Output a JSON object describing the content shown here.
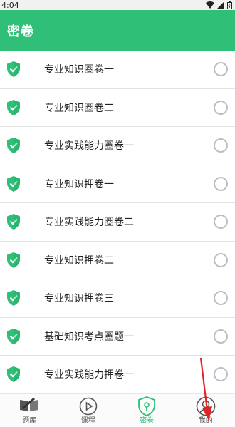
{
  "status_bar": {
    "time": "4:04"
  },
  "app_bar": {
    "title": "密卷"
  },
  "papers": [
    {
      "title": "专业知识圈卷一"
    },
    {
      "title": "专业知识圈卷二"
    },
    {
      "title": "专业实践能力圈卷一"
    },
    {
      "title": "专业知识押卷一"
    },
    {
      "title": "专业实践能力圈卷二"
    },
    {
      "title": "专业知识押卷二"
    },
    {
      "title": "专业知识押卷三"
    },
    {
      "title": "基础知识考点圈题一"
    },
    {
      "title": "专业实践能力押卷一"
    }
  ],
  "tabs": [
    {
      "label": "题库",
      "icon": "book-icon",
      "active": false
    },
    {
      "label": "课程",
      "icon": "play-icon",
      "active": false
    },
    {
      "label": "密卷",
      "icon": "lock-shield-icon",
      "active": true
    },
    {
      "label": "我的",
      "icon": "user-icon",
      "active": false
    }
  ],
  "colors": {
    "accent": "#2fbf77",
    "shield": "#2fbf77",
    "arrow": "#e02424"
  }
}
